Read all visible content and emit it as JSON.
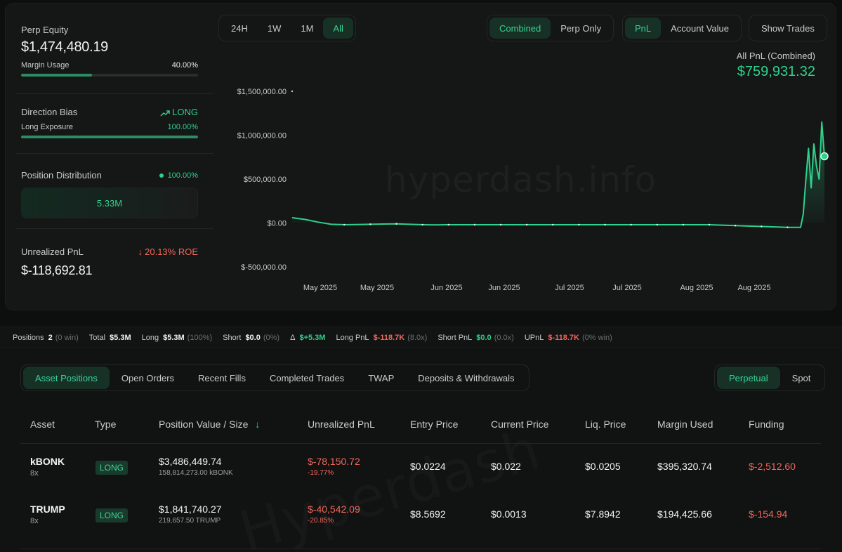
{
  "summary": {
    "perp_equity_label": "Perp Equity",
    "perp_equity_value": "$1,474,480.19",
    "margin_usage_label": "Margin Usage",
    "margin_usage_value": "40.00%",
    "margin_usage_fraction": 0.4,
    "direction_bias_label": "Direction Bias",
    "direction_bias_value": "LONG",
    "long_exposure_label": "Long Exposure",
    "long_exposure_value": "100.00%",
    "long_exposure_fraction": 1.0,
    "position_distribution_label": "Position Distribution",
    "position_distribution_pct": "100.00%",
    "position_distribution_amount": "5.33M",
    "unrealized_pnl_label": "Unrealized PnL",
    "unrealized_pnl_roe": "20.13% ROE",
    "unrealized_pnl_value": "$-118,692.81"
  },
  "range_tabs": [
    {
      "label": "24H",
      "active": false
    },
    {
      "label": "1W",
      "active": false
    },
    {
      "label": "1M",
      "active": false
    },
    {
      "label": "All",
      "active": true
    }
  ],
  "mode_tabs": [
    {
      "label": "Combined",
      "active": true
    },
    {
      "label": "Perp Only",
      "active": false
    }
  ],
  "metric_tabs": [
    {
      "label": "PnL",
      "active": true
    },
    {
      "label": "Account Value",
      "active": false
    }
  ],
  "show_trades_label": "Show Trades",
  "pnl_header": {
    "label": "All PnL (Combined)",
    "value": "$759,931.32"
  },
  "watermarks": {
    "chart": "hyperdash.info",
    "table": "Hyperdash"
  },
  "chart_data": {
    "type": "area",
    "y_ticks": [
      "$1,500,000.00",
      "$1,000,000.00",
      "$500,000.00",
      "$0.00",
      "$-500,000.00"
    ],
    "y_tick_values": [
      1500000,
      1000000,
      500000,
      0,
      -500000
    ],
    "ylim": [
      -500000,
      1500000
    ],
    "x_ticks": [
      "May 2025",
      "May 2025",
      "Jun 2025",
      "Jun 2025",
      "Jul 2025",
      "Jul 2025",
      "Aug 2025",
      "Aug 2025"
    ],
    "series": [
      {
        "values": [
          60000,
          40000,
          10000,
          -15000,
          -20000,
          -18000,
          -15000,
          -12000,
          -10000,
          -15000,
          -20000,
          -22000,
          -20000,
          -20000,
          -20000,
          -20000,
          -20000,
          -20000,
          -20000,
          -20000,
          -20000,
          -20000,
          -20000,
          -20000,
          -20000,
          -20000,
          -20000,
          -20000,
          -20000,
          -20000,
          -20000,
          -20000,
          -20000,
          -25000,
          -30000,
          -35000,
          -40000,
          -45000,
          -50000,
          -50000,
          100000,
          500000,
          850000,
          400000,
          900000,
          650000,
          500000,
          1150000,
          760000
        ]
      }
    ],
    "line_color": "#2fd08c",
    "grid": false
  },
  "stats_bar": [
    {
      "key": "Positions",
      "value": "2",
      "meta": "(0 win)",
      "value_color": "#f2f3f3"
    },
    {
      "key": "Total",
      "value": "$5.3M",
      "meta": "",
      "value_color": "#f2f3f3"
    },
    {
      "key": "Long",
      "value": "$5.3M",
      "meta": "(100%)",
      "value_color": "#f2f3f3"
    },
    {
      "key": "Short",
      "value": "$0.0",
      "meta": "(0%)",
      "value_color": "#f2f3f3"
    },
    {
      "key": "Δ",
      "value": "$+5.3M",
      "meta": "",
      "value_color": "#2fd08c"
    },
    {
      "key": "Long PnL",
      "value": "$-118.7K",
      "meta": "(8.0x)",
      "value_color": "#f0675c"
    },
    {
      "key": "Short PnL",
      "value": "$0.0",
      "meta": "(0.0x)",
      "value_color": "#2fd08c"
    },
    {
      "key": "UPnL",
      "value": "$-118.7K",
      "meta": "(0% win)",
      "value_color": "#f0675c"
    }
  ],
  "table_tabs": [
    {
      "label": "Asset Positions",
      "active": true
    },
    {
      "label": "Open Orders",
      "active": false
    },
    {
      "label": "Recent Fills",
      "active": false
    },
    {
      "label": "Completed Trades",
      "active": false
    },
    {
      "label": "TWAP",
      "active": false
    },
    {
      "label": "Deposits & Withdrawals",
      "active": false
    }
  ],
  "market_tabs": [
    {
      "label": "Perpetual",
      "active": true
    },
    {
      "label": "Spot",
      "active": false
    }
  ],
  "table": {
    "headers": [
      "Asset",
      "Type",
      "Position Value / Size",
      "Unrealized PnL",
      "Entry Price",
      "Current Price",
      "Liq. Price",
      "Margin Used",
      "Funding"
    ],
    "sort_icon": "arrow-down-icon",
    "rows": [
      {
        "asset": "kBONK",
        "leverage": "8x",
        "type": "LONG",
        "value": "$3,486,449.74",
        "size": "158,814,273.00 kBONK",
        "upnl": "$-78,150.72",
        "upnl_pct": "-19.77%",
        "entry": "$0.0224",
        "current": "$0.022",
        "liq": "$0.0205",
        "margin": "$395,320.74",
        "funding": "$-2,512.60"
      },
      {
        "asset": "TRUMP",
        "leverage": "8x",
        "type": "LONG",
        "value": "$1,841,740.27",
        "size": "219,657.50 TRUMP",
        "upnl": "$-40,542.09",
        "upnl_pct": "-20.85%",
        "entry": "$8.5692",
        "current": "$0.0013",
        "liq": "$7.8942",
        "margin": "$194,425.66",
        "funding": "$-154.94"
      }
    ]
  }
}
